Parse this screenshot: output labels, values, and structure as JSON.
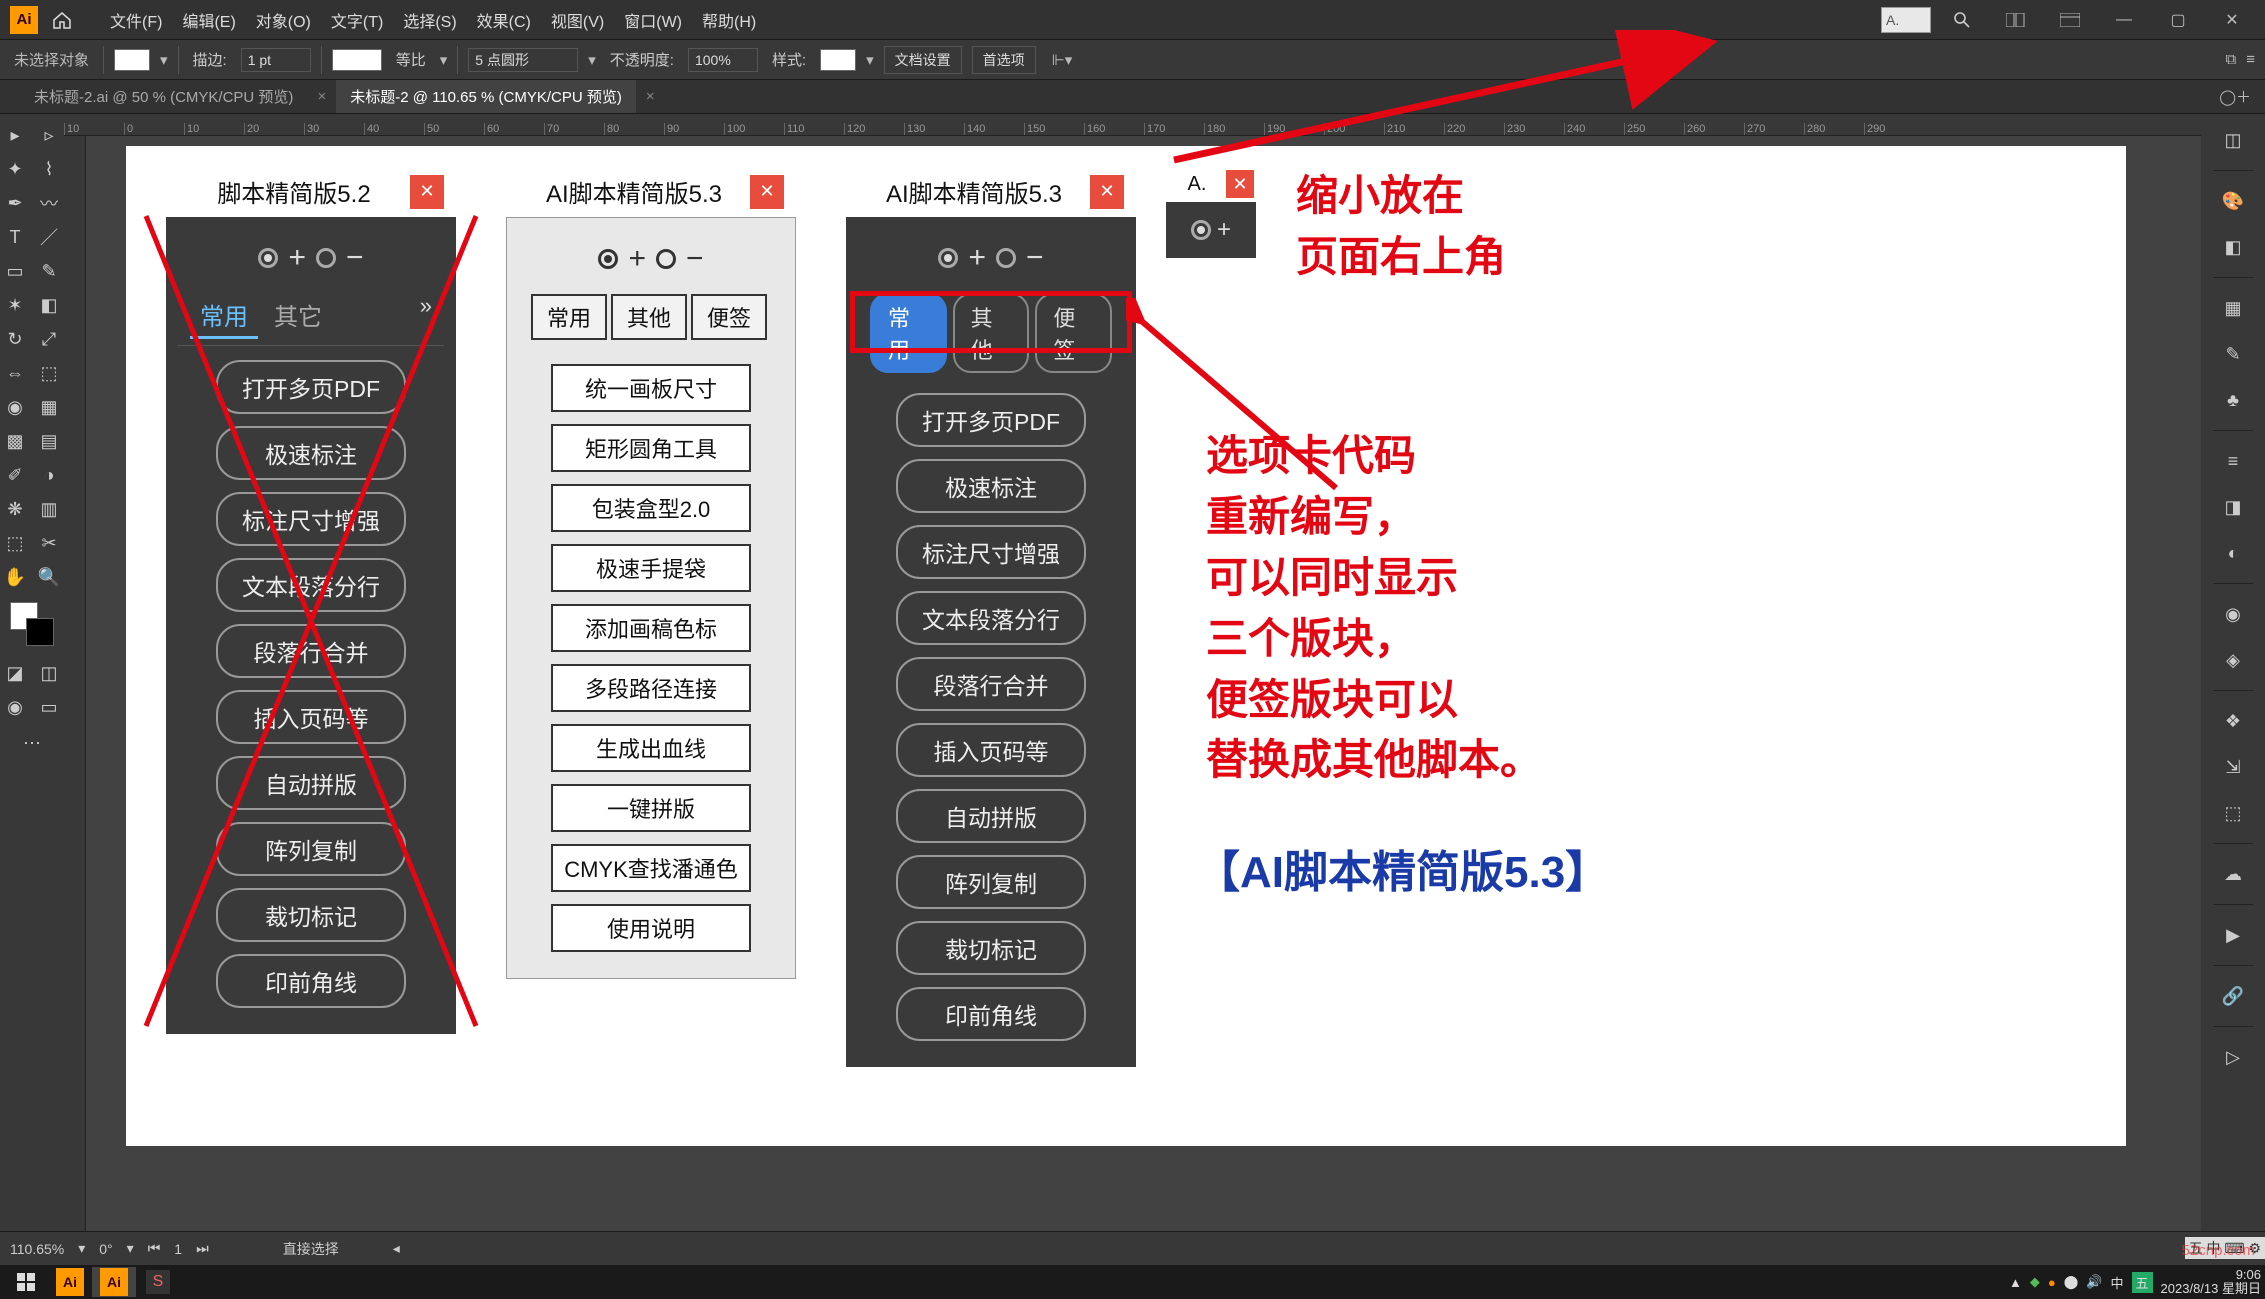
{
  "menubar": {
    "items": [
      "文件(F)",
      "编辑(E)",
      "对象(O)",
      "文字(T)",
      "选择(S)",
      "效果(C)",
      "视图(V)",
      "窗口(W)",
      "帮助(H)"
    ]
  },
  "options": {
    "no_selection": "未选择对象",
    "stroke_label": "描边:",
    "stroke_value": "1 pt",
    "uniform": "等比",
    "brush_value": "5 点圆形",
    "opacity_label": "不透明度:",
    "opacity_value": "100%",
    "style_label": "样式:",
    "doc_setup": "文档设置",
    "prefs": "首选项"
  },
  "tabs": {
    "items": [
      {
        "label": "未标题-2.ai @ 50 % (CMYK/CPU 预览)",
        "active": false
      },
      {
        "label": "未标题-2 @ 110.65 % (CMYK/CPU 预览)",
        "active": true
      }
    ]
  },
  "ruler_marks": [
    "10",
    "0",
    "10",
    "20",
    "30",
    "40",
    "50",
    "60",
    "70",
    "80",
    "90",
    "100",
    "110",
    "120",
    "130",
    "140",
    "150",
    "160",
    "170",
    "180",
    "190",
    "200",
    "210",
    "220",
    "230",
    "240",
    "250",
    "260",
    "270",
    "280",
    "290"
  ],
  "panel52": {
    "title": "脚本精简版5.2",
    "tabs": [
      "常用",
      "其它"
    ],
    "buttons": [
      "打开多页PDF",
      "极速标注",
      "标注尺寸增强",
      "文本段落分行",
      "段落行合并",
      "插入页码等",
      "自动拼版",
      "阵列复制",
      "裁切标记",
      "印前角线"
    ]
  },
  "panel53light": {
    "title": "AI脚本精简版5.3",
    "tabs": [
      "常用",
      "其他",
      "便签"
    ],
    "buttons": [
      "统一画板尺寸",
      "矩形圆角工具",
      "包装盒型2.0",
      "极速手提袋",
      "添加画稿色标",
      "多段路径连接",
      "生成出血线",
      "一键拼版",
      "CMYK查找潘通色",
      "使用说明"
    ]
  },
  "panel53dark": {
    "title": "AI脚本精简版5.3",
    "tabs": [
      "常用",
      "其他",
      "便签"
    ],
    "buttons": [
      "打开多页PDF",
      "极速标注",
      "标注尺寸增强",
      "文本段落分行",
      "段落行合并",
      "插入页码等",
      "自动拼版",
      "阵列复制",
      "裁切标记",
      "印前角线"
    ]
  },
  "panel_mini": {
    "title": "A."
  },
  "annotations": {
    "top": "缩小放在\n页面右上角",
    "mid": "选项卡代码\n重新编写，\n可以同时显示\n三个版块，\n便签版块可以\n替换成其他脚本。",
    "bottom": "【AI脚本精简版5.3】"
  },
  "search_box_hint": "A.",
  "statusbar": {
    "zoom": "110.65%",
    "rotate": "0°",
    "artboard": "1",
    "tool": "直接选择"
  },
  "ime_tray": "五 中 ⌨ ⚙",
  "clock": {
    "time": "9:06",
    "date": "2023/8/13 星期日"
  },
  "watermark": "52cnp.com"
}
